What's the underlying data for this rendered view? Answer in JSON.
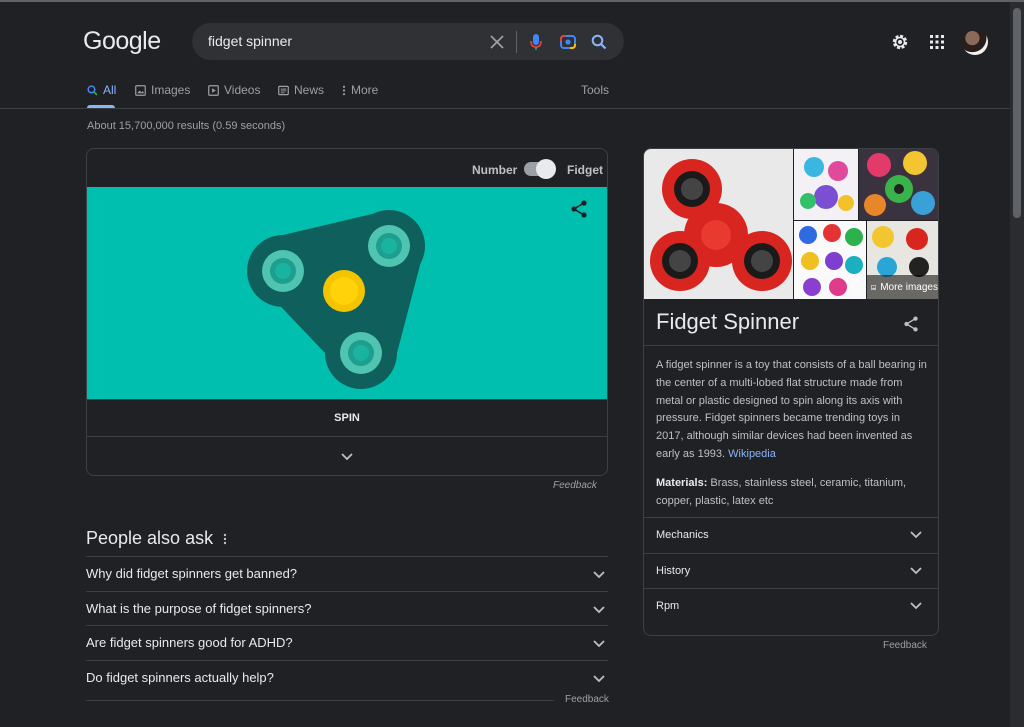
{
  "header": {
    "logo": "Google",
    "search": {
      "value": "fidget spinner",
      "placeholder": ""
    },
    "icons": {
      "clear": "close-icon",
      "voice": "microphone-icon",
      "lens": "camera-lens-icon",
      "search": "search-icon",
      "settings": "gear-icon",
      "apps": "apps-grid-icon",
      "account": "avatar"
    }
  },
  "tabs": {
    "items": [
      {
        "label": "All",
        "icon": "search-icon"
      },
      {
        "label": "Images",
        "icon": "image-icon"
      },
      {
        "label": "Videos",
        "icon": "play-icon"
      },
      {
        "label": "News",
        "icon": "news-icon"
      },
      {
        "label": "More",
        "icon": "more-vertical-icon"
      }
    ],
    "tools": "Tools"
  },
  "result_stats": "About 15,700,000 results (0.59 seconds)",
  "spinner_card": {
    "toggle_left": "Number",
    "toggle_right": "Fidget",
    "toggle_on": true,
    "spin_label": "SPIN",
    "stage_color": "#00bfae",
    "feedback": "Feedback"
  },
  "people_also_ask": {
    "title": "People also ask",
    "questions": [
      "Why did fidget spinners get banned?",
      "What is the purpose of fidget spinners?",
      "Are fidget spinners good for ADHD?",
      "Do fidget spinners actually help?"
    ],
    "feedback": "Feedback"
  },
  "knowledge_panel": {
    "more_images": "More images",
    "title": "Fidget Spinner",
    "description": "A fidget spinner is a toy that consists of a ball bearing in the center of a multi-lobed flat structure made from metal or plastic designed to spin along its axis with pressure. Fidget spinners became trending toys in 2017, although similar devices had been invented as early as 1993.",
    "source_link": "Wikipedia",
    "materials_label": "Materials:",
    "materials_value": "Brass, stainless steel, ceramic, titanium, copper, plastic, latex etc",
    "rows": [
      "Mechanics",
      "History",
      "Rpm"
    ],
    "feedback": "Feedback"
  },
  "colors": {
    "background": "#202124",
    "accent": "#8ab4f8",
    "text": "#bdc1c6"
  }
}
